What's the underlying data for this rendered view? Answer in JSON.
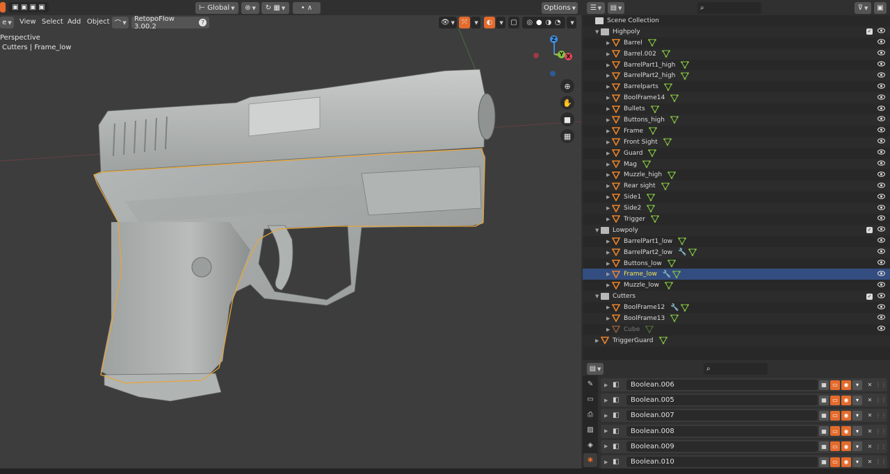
{
  "viewport": {
    "header": {
      "orientation": "Global",
      "options": "Options"
    },
    "menu": {
      "view": "View",
      "select": "Select",
      "add": "Add",
      "object": "Object",
      "addon": "RetopoFlow 3.00.2",
      "help": "?"
    },
    "overlay": {
      "line1": "Perspective",
      "line2": "Cutters | Frame_low"
    },
    "gizmo": {
      "z": "Z",
      "y": "Y",
      "x": "X"
    },
    "colors": {
      "selection_outline": "#e8a53a",
      "axis_x": "#e0445a",
      "axis_y": "#84c341",
      "axis_z": "#3d8de0"
    }
  },
  "outliner": {
    "scene_collection": "Scene Collection",
    "collections": [
      {
        "name": "Highpoly",
        "items": [
          {
            "name": "Barrel",
            "wrench": false
          },
          {
            "name": "Barrel.002",
            "wrench": false
          },
          {
            "name": "BarrelPart1_high",
            "wrench": false
          },
          {
            "name": "BarrelPart2_high",
            "wrench": false
          },
          {
            "name": "Barrelparts",
            "wrench": false
          },
          {
            "name": "BoolFrame14",
            "wrench": false
          },
          {
            "name": "Bullets",
            "wrench": false
          },
          {
            "name": "Buttons_high",
            "wrench": false
          },
          {
            "name": "Frame",
            "wrench": false
          },
          {
            "name": "Front Sight",
            "wrench": false
          },
          {
            "name": "Guard",
            "wrench": false
          },
          {
            "name": "Mag",
            "wrench": false
          },
          {
            "name": "Muzzle_high",
            "wrench": false
          },
          {
            "name": "Rear sight",
            "wrench": false
          },
          {
            "name": "Side1",
            "wrench": false
          },
          {
            "name": "Side2",
            "wrench": false
          },
          {
            "name": "Trigger",
            "wrench": false
          }
        ]
      },
      {
        "name": "Lowpoly",
        "items": [
          {
            "name": "BarrelPart1_low",
            "wrench": false
          },
          {
            "name": "BarrelPart2_low",
            "wrench": true
          },
          {
            "name": "Buttons_low",
            "wrench": false
          },
          {
            "name": "Frame_low",
            "wrench": true,
            "selected": true
          },
          {
            "name": "Muzzle_low",
            "wrench": false
          }
        ]
      },
      {
        "name": "Cutters",
        "items": [
          {
            "name": "BoolFrame12",
            "wrench": true
          },
          {
            "name": "BoolFrame13",
            "wrench": false
          },
          {
            "name": "Cube",
            "wrench": false,
            "dimmed": true
          }
        ]
      }
    ],
    "root_object": "TriggerGuard"
  },
  "properties": {
    "modifiers": [
      "Boolean.006",
      "Boolean.005",
      "Boolean.007",
      "Boolean.008",
      "Boolean.009",
      "Boolean.010"
    ]
  }
}
